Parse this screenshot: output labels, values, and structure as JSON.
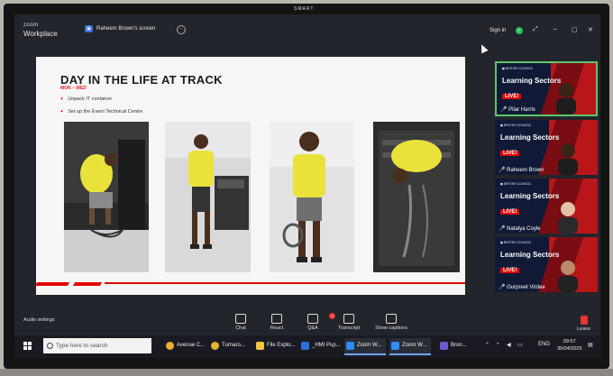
{
  "monitor": {
    "brand": "SMART"
  },
  "window": {
    "app_logo_line1": "zoom",
    "app_logo_line2": "Workplace",
    "share_label": "Raheem Brown's screen",
    "sign_in": "Sign in"
  },
  "slide": {
    "title": "DAY IN THE LIFE AT TRACK",
    "subtitle": "MON – WED",
    "bullets": [
      "Unpack IT container",
      "Set up the Event Technical Centre"
    ]
  },
  "participants": [
    {
      "name": "Pilar Harris",
      "title": "Learning Sectors",
      "live": "LIVE!",
      "active": true
    },
    {
      "name": "Raheem Brown",
      "title": "Learning Sectors",
      "live": "LIVE!",
      "active": false
    },
    {
      "name": "Natalya Coyle",
      "title": "Learning Sectors",
      "live": "LIVE!",
      "active": false
    },
    {
      "name": "Gurpreet Virdee",
      "title": "Learning Sectors",
      "live": "LIVE!",
      "active": false
    }
  ],
  "controls": {
    "audio_settings": "Audio settings",
    "chat": "Chat",
    "react": "React",
    "qa": "Q&A",
    "qa_badge": "3",
    "transcript": "Transcript",
    "captions": "Show captions",
    "leave": "Leave"
  },
  "taskbar": {
    "search_placeholder": "Type here to search",
    "apps": [
      {
        "label": "Avenue C...",
        "color": "#e8b12e"
      },
      {
        "label": "Turnaro...",
        "color": "#e8b12e"
      },
      {
        "label": "File Explo...",
        "color": "#f2c744"
      },
      {
        "label": "_HMI Pup...",
        "color": "#2d6fdb"
      },
      {
        "label": "Zoom W...",
        "color": "#2d8cff"
      },
      {
        "label": "Zoom W...",
        "color": "#2d8cff"
      },
      {
        "label": "Bron...",
        "color": "#6a5acd"
      }
    ],
    "lang": "ENG",
    "time": "09:57",
    "date": "30/04/2025"
  }
}
